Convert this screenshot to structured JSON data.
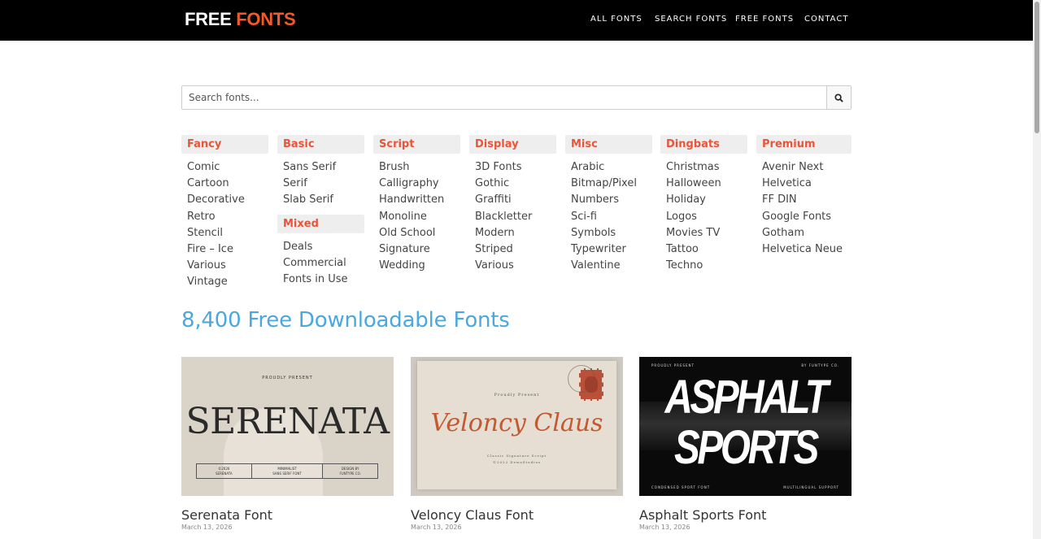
{
  "header": {
    "logo_part1": "FREE",
    "logo_part2": "FONTS",
    "nav": [
      "ALL FONTS",
      "SEARCH FONTS",
      "FREE FONTS",
      "CONTACT"
    ]
  },
  "search": {
    "placeholder": "Search fonts..."
  },
  "categories": [
    {
      "title": "Fancy",
      "items": [
        "Comic",
        "Cartoon",
        "Decorative",
        "Retro",
        "Stencil",
        "Fire – Ice",
        "Various",
        "Vintage"
      ]
    },
    {
      "title": "Basic",
      "items": [
        "Sans Serif",
        "Serif",
        "Slab Serif"
      ],
      "subtitle": "Mixed",
      "subitems": [
        "Deals",
        "Commercial",
        "Fonts in Use"
      ]
    },
    {
      "title": "Script",
      "items": [
        "Brush",
        "Calligraphy",
        "Handwritten",
        "Monoline",
        "Old School",
        "Signature",
        "Wedding"
      ]
    },
    {
      "title": "Display",
      "items": [
        "3D Fonts",
        "Gothic",
        "Graffiti",
        "Blackletter",
        "Modern",
        "Striped",
        "Various"
      ]
    },
    {
      "title": "Misc",
      "items": [
        "Arabic",
        "Bitmap/Pixel",
        "Numbers",
        "Sci-fi",
        "Symbols",
        "Typewriter",
        "Valentine"
      ]
    },
    {
      "title": "Dingbats",
      "items": [
        "Christmas",
        "Halloween",
        "Holiday",
        "Logos",
        "Movies TV",
        "Tattoo",
        "Techno"
      ]
    },
    {
      "title": "Premium",
      "items": [
        "Avenir Next",
        "Helvetica",
        "FF DIN",
        "Google Fonts",
        "Gotham",
        "Helvetica Neue"
      ]
    }
  ],
  "headline": "8,400 Free Downloadable Fonts",
  "fonts": [
    {
      "title": "Serenata Font",
      "date": "March 13, 2026",
      "thumb": {
        "top": "PROUDLY PRESENT",
        "name": "SERENATA",
        "info": [
          "©2026\nSERENATA",
          "MINIMALIST\nSANS SERIF FONT",
          "DESIGN BY\nFUNTYPE CO."
        ]
      }
    },
    {
      "title": "Veloncy Claus Font",
      "date": "March 13, 2026",
      "thumb": {
        "top": "Proudly Present",
        "name": "Veloncy Claus",
        "info": [
          "Classic Signature Script",
          "©2022 DewaStudios"
        ]
      }
    },
    {
      "title": "Asphalt Sports Font",
      "date": "March 13, 2026",
      "thumb": {
        "top_left": "PROUDLY PRESENT",
        "top_right": "BY FUNTYPE CO.",
        "name_line1": "ASPHALT",
        "name_line2": "SPORTS",
        "bottom_left": "CONDENSED SPORT FONT",
        "bottom_right": "MULTILINGUAL SUPPORT"
      }
    }
  ],
  "colors": {
    "accent": "#e8553a",
    "logo_orange": "#f25a2c",
    "headline_blue": "#4aa8df",
    "nav_bg": "#000000"
  }
}
